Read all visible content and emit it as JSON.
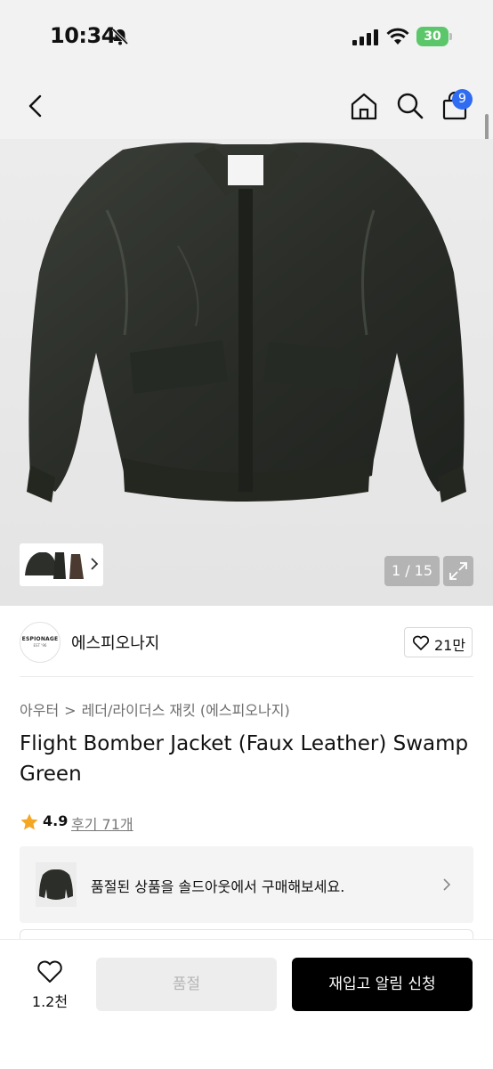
{
  "status_bar": {
    "time": "10:34",
    "battery": "30"
  },
  "nav": {
    "cart_count": "9"
  },
  "gallery": {
    "counter": "1 / 15"
  },
  "brand": {
    "name": "에스피오나지",
    "logo_text": "ESPIONAGE",
    "logo_sub": "EST '96",
    "likes": "21만"
  },
  "breadcrumb": {
    "category": "아우터",
    "separator": ">",
    "subcategory": "레더/라이더스 재킷 (에스피오나지)"
  },
  "product": {
    "title": "Flight Bomber Jacket (Faux Leather) Swamp Green",
    "rating": "4.9",
    "reviews": "후기 71개"
  },
  "soldout_banner": {
    "text": "품절된 상품을 솔드아웃에서 구매해보세요."
  },
  "bottom_bar": {
    "wish_count": "1.2천",
    "soldout_label": "품절",
    "notify_label": "재입고 알림 신청"
  },
  "colors": {
    "accent_blue": "#2f6cf2",
    "star": "#f5a623",
    "battery": "#5cc76a",
    "primary_button": "#000000"
  }
}
